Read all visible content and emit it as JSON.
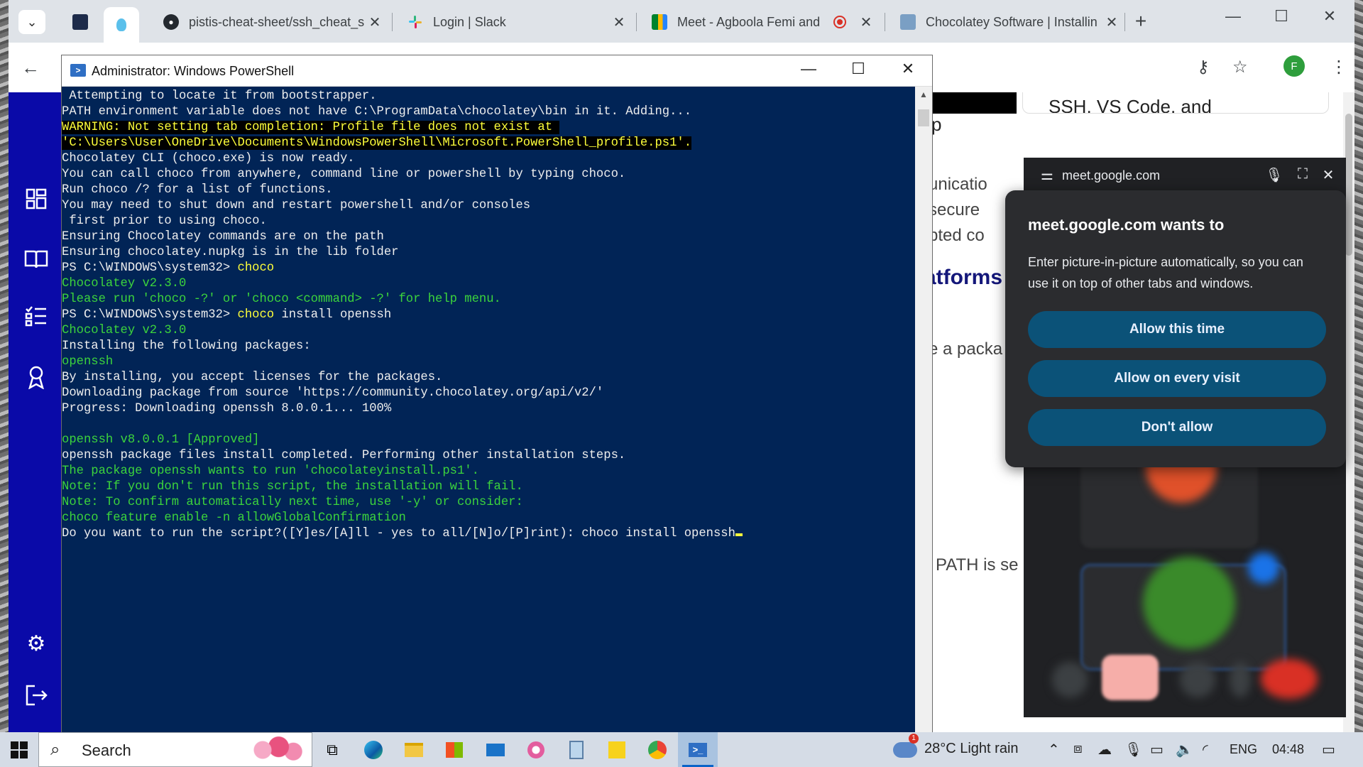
{
  "chrome": {
    "tabs": [
      {
        "title": "pistis-cheat-sheet/ssh_cheat_s",
        "close": "✕"
      },
      {
        "title": "Login | Slack",
        "close": "✕"
      },
      {
        "title": "Meet - Agboola Femi and",
        "close": "✕"
      },
      {
        "title": "Chocolatey Software | Installin",
        "close": "✕"
      }
    ],
    "new_tab": "+",
    "window_controls": {
      "minimize": "—",
      "maximize": "☐",
      "close": "✕"
    },
    "profile_initial": "F",
    "accent": "#1a73e8"
  },
  "webpage": {
    "card_text": "SSH, VS Code, and",
    "snippets": [
      "unicatio",
      "secure",
      "pted  co",
      "atforms",
      "e a packa",
      "PATH is se",
      "p"
    ]
  },
  "powershell": {
    "title": "Administrator: Windows PowerShell",
    "lines": [
      {
        "t": " Attempting to locate it from bootstrapper.",
        "c": "w"
      },
      {
        "t": "PATH environment variable does not have C:\\ProgramData\\chocolatey\\bin in it. Adding...",
        "c": "w"
      },
      {
        "t": "WARNING: Not setting tab completion: Profile file does not exist at ",
        "c": "warn"
      },
      {
        "t": "'C:\\Users\\User\\OneDrive\\Documents\\WindowsPowerShell\\Microsoft.PowerShell_profile.ps1'.",
        "c": "warn"
      },
      {
        "t": "Chocolatey CLI (choco.exe) is now ready.",
        "c": "w"
      },
      {
        "t": "You can call choco from anywhere, command line or powershell by typing choco.",
        "c": "w"
      },
      {
        "t": "Run choco /? for a list of functions.",
        "c": "w"
      },
      {
        "t": "You may need to shut down and restart powershell and/or consoles",
        "c": "w"
      },
      {
        "t": " first prior to using choco.",
        "c": "w"
      },
      {
        "t": "Ensuring Chocolatey commands are on the path",
        "c": "w"
      },
      {
        "t": "Ensuring chocolatey.nupkg is in the lib folder",
        "c": "w"
      },
      {
        "t": "PS C:\\WINDOWS\\system32> ",
        "c": "prompt",
        "cmd": "choco",
        "args": ""
      },
      {
        "t": "Chocolatey v2.3.0",
        "c": "g"
      },
      {
        "t": "Please run 'choco -?' or 'choco <command> -?' for help menu.",
        "c": "g"
      },
      {
        "t": "PS C:\\WINDOWS\\system32> ",
        "c": "prompt",
        "cmd": "choco",
        "args": " install openssh"
      },
      {
        "t": "Chocolatey v2.3.0",
        "c": "g"
      },
      {
        "t": "Installing the following packages:",
        "c": "w"
      },
      {
        "t": "openssh",
        "c": "g"
      },
      {
        "t": "By installing, you accept licenses for the packages.",
        "c": "w"
      },
      {
        "t": "Downloading package from source 'https://community.chocolatey.org/api/v2/'",
        "c": "w"
      },
      {
        "t": "Progress: Downloading openssh 8.0.0.1... 100%",
        "c": "w"
      },
      {
        "t": "",
        "c": "w"
      },
      {
        "t": "openssh v8.0.0.1 [Approved]",
        "c": "g"
      },
      {
        "t": "openssh package files install completed. Performing other installation steps.",
        "c": "w"
      },
      {
        "t": "The package openssh wants to run 'chocolateyinstall.ps1'.",
        "c": "g"
      },
      {
        "t": "Note: If you don't run this script, the installation will fail.",
        "c": "g"
      },
      {
        "t": "Note: To confirm automatically next time, use '-y' or consider:",
        "c": "g"
      },
      {
        "t": "choco feature enable -n allowGlobalConfirmation",
        "c": "g"
      },
      {
        "t": "Do you want to run the script?([Y]es/[A]ll - yes to all/[N]o/[P]rint): choco install openssh",
        "c": "w",
        "cursor": true
      }
    ],
    "colors": {
      "background": "#012456",
      "text": "#eeeeee",
      "green": "#3cd43c",
      "yellow": "#ffff3a"
    }
  },
  "pip": {
    "host": "meet.google.com"
  },
  "permission": {
    "heading": "meet.google.com wants to",
    "body": "Enter picture-in-picture automatically, so you can use it on top of other tabs and windows.",
    "buttons": [
      "Allow this time",
      "Allow on every visit",
      "Don't allow"
    ],
    "button_color": "#0b5278"
  },
  "taskbar": {
    "search_label": "Search",
    "weather": "28°C  Light rain",
    "weather_badge": "1",
    "language": "ENG",
    "time": "04:48"
  }
}
